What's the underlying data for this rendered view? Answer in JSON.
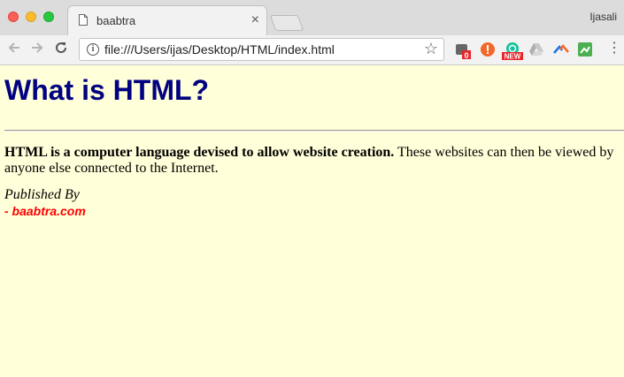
{
  "browser": {
    "tab_title": "baabtra",
    "tab_close": "×",
    "profile_name": "Ijasali",
    "url": "file:///Users/ijas/Desktop/HTML/index.html",
    "back_icon": "arrow-left-icon",
    "forward_icon": "arrow-right-icon",
    "reload_icon": "reload-icon",
    "star_icon": "☆",
    "menu_icon": "⋮",
    "extensions": [
      {
        "name": "extension-badge-icon",
        "badge": "0"
      },
      {
        "name": "extension-alert-icon"
      },
      {
        "name": "extension-grammarly-icon",
        "badge": "NEW"
      },
      {
        "name": "google-drive-icon"
      },
      {
        "name": "extension-rainbow-icon"
      },
      {
        "name": "extension-green-icon"
      }
    ]
  },
  "page": {
    "heading": "What is HTML?",
    "intro_bold": "HTML is a computer language devised to allow website creation.",
    "intro_rest": " These websites can then be viewed by anyone else connected to the Internet.",
    "published_by": "Published By",
    "author": "- baabtra.com"
  },
  "colors": {
    "page_background": "#ffffd9",
    "heading": "#000080",
    "author": "#ff0000"
  }
}
